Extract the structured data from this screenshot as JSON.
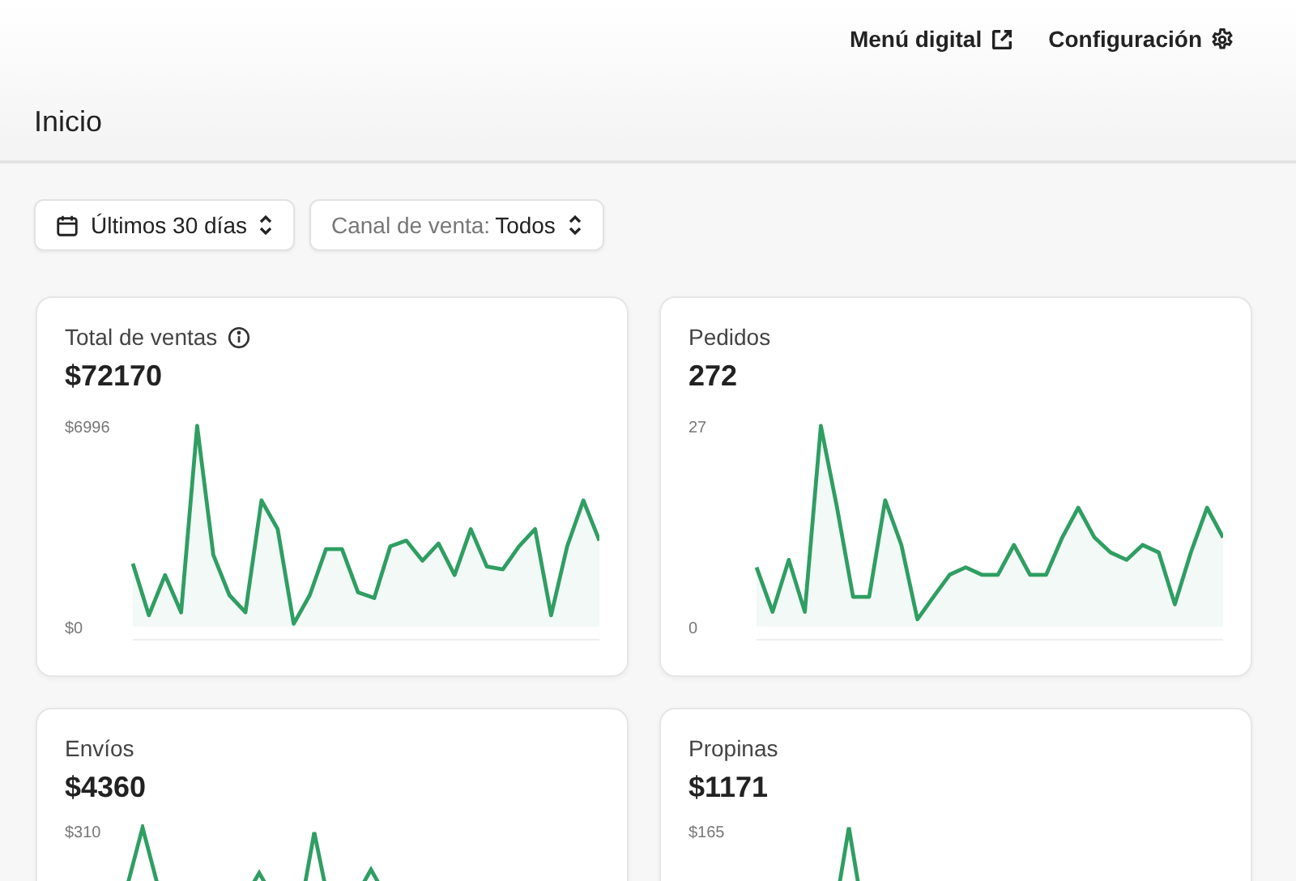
{
  "top_nav": {
    "links": [
      {
        "label": "Menú digital"
      },
      {
        "label": "Configuración"
      }
    ]
  },
  "page_title": "Inicio",
  "filters": [
    {
      "kind": "date",
      "value": "Últimos 30 días"
    },
    {
      "kind": "channel",
      "label": "Canal de venta:",
      "value": "Todos"
    }
  ],
  "cards": [
    {
      "title": "Total de ventas",
      "info": true,
      "value": "$72170",
      "chart_data": {
        "type": "area",
        "yticks": [
          {
            "value": 0,
            "label": "$0"
          },
          {
            "value": 6996,
            "label": "$6996"
          }
        ],
        "ylim": [
          0,
          6996
        ],
        "series": [
          {
            "color": "#2f9e63",
            "values": [
              2200,
              400,
              1800,
              500,
              6996,
              2500,
              1100,
              500,
              4400,
              3400,
              100,
              1100,
              2700,
              2700,
              1200,
              1000,
              2800,
              3000,
              2300,
              2900,
              1800,
              3400,
              2100,
              2000,
              2800,
              3400,
              400,
              2800,
              4400,
              3000
            ]
          }
        ]
      }
    },
    {
      "title": "Pedidos",
      "info": false,
      "value": "272",
      "chart_data": {
        "type": "area",
        "yticks": [
          {
            "value": 0,
            "label": "0"
          },
          {
            "value": 27,
            "label": "27"
          }
        ],
        "ylim": [
          0,
          27
        ],
        "series": [
          {
            "color": "#2f9e63",
            "values": [
              8,
              2,
              9,
              2,
              27,
              16,
              4,
              4,
              17,
              11,
              1,
              4,
              7,
              8,
              7,
              7,
              11,
              7,
              7,
              12,
              16,
              12,
              10,
              9,
              11,
              10,
              3,
              10,
              16,
              12
            ]
          }
        ]
      }
    },
    {
      "title": "Envíos",
      "info": false,
      "value": "$4360",
      "top_label": "$310"
    },
    {
      "title": "Propinas",
      "info": false,
      "value": "$1171",
      "top_label": "$165"
    }
  ]
}
